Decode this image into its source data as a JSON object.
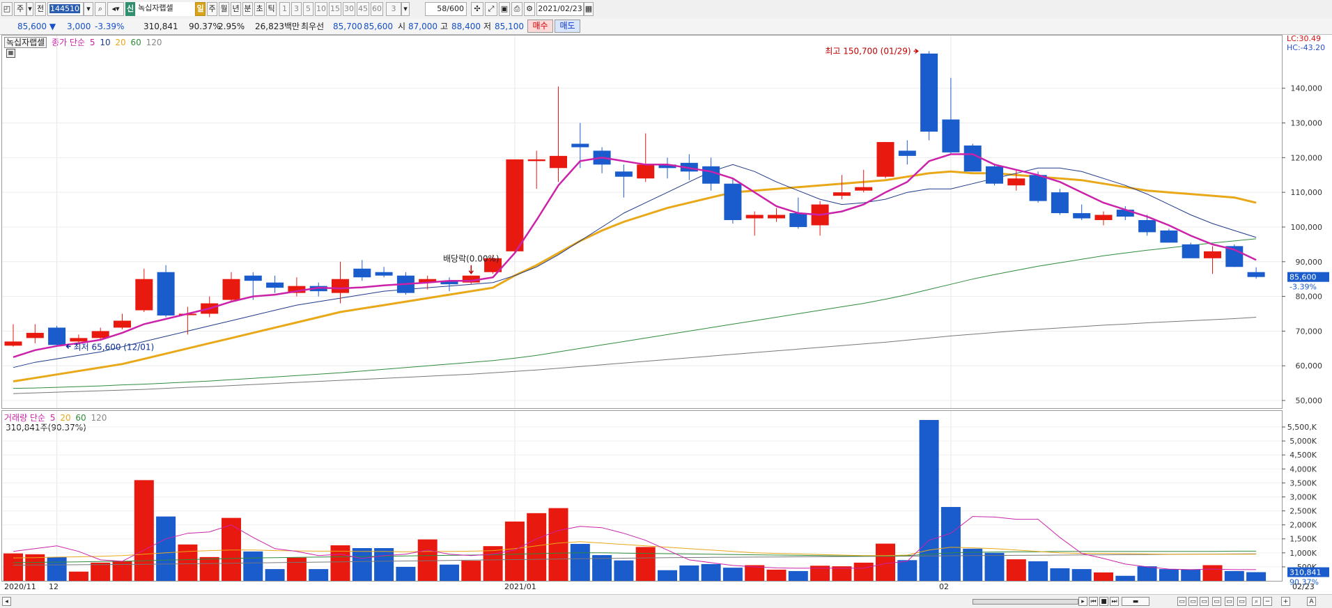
{
  "toolbar": {
    "mode_char": "주",
    "prev_char": "전",
    "code": "144510",
    "tag": "신",
    "stock_name": "녹십자랩셀",
    "periods": [
      "일",
      "주",
      "월",
      "년",
      "분",
      "초",
      "틱"
    ],
    "intervals": [
      "1",
      "3",
      "5",
      "10",
      "15",
      "30",
      "45",
      "60"
    ],
    "interval_value": "3",
    "count": "58/600",
    "date": "2021/02/23"
  },
  "quote": {
    "price": "85,600",
    "arrow": "▼",
    "change": "3,000",
    "change_pct": "-3.39%",
    "volume": "310,841",
    "vol_ratio": "90.37%",
    "turnover": "2.95%",
    "amount": "26,823백만",
    "best_label": "최우선",
    "best_ask": "85,700",
    "best_bid": "85,600",
    "open_label": "시",
    "open": "87,000",
    "high_label": "고",
    "high": "88,400",
    "low_label": "저",
    "low": "85,100",
    "buy_label": "매수",
    "sell_label": "매도"
  },
  "price_legend": {
    "name": "녹십자랩셀",
    "ma_label": "종가 단순",
    "periods": [
      "5",
      "10",
      "20",
      "60",
      "120"
    ]
  },
  "volume_legend": {
    "ma_label": "거래량 단순",
    "periods": [
      "5",
      "20",
      "60",
      "120"
    ],
    "current": "310,841주(90.37%)"
  },
  "side_labels": {
    "lc": "LC:30.49",
    "hc": "HC:-43.20",
    "last_price": "85,600",
    "last_pct": "-3.39%",
    "last_vol": "310,841",
    "last_vol_pct": "90.37%"
  },
  "annotations": {
    "high": "최고 150,700 (01/29)",
    "low": "최저 65,600 (12/01)",
    "dividend": "배당락(0.00%)"
  },
  "x_labels": [
    "2020/11",
    "12",
    "2021/01",
    "02",
    "02/23"
  ],
  "colors": {
    "up": "#e8190e",
    "down": "#1a5ccc",
    "ma5": "#cc22aa",
    "ma10": "#1f3a8a",
    "ma20": "#e8a818",
    "ma60": "#2e8b3c",
    "ma120": "#777777"
  },
  "chart_data": [
    {
      "type": "candlestick",
      "title": "녹십자랩셀",
      "ylim": [
        48000,
        155000
      ],
      "yticks": [
        "50,000",
        "60,000",
        "70,000",
        "80,000",
        "90,000",
        "100,000",
        "110,000",
        "120,000",
        "130,000",
        "140,000"
      ],
      "ohlc": [
        {
          "o": 65800,
          "h": 72000,
          "l": 65500,
          "c": 67000
        },
        {
          "o": 68000,
          "h": 72000,
          "l": 66500,
          "c": 69500
        },
        {
          "o": 71000,
          "h": 71500,
          "l": 65600,
          "c": 66000
        },
        {
          "o": 67000,
          "h": 69000,
          "l": 66200,
          "c": 68000
        },
        {
          "o": 68000,
          "h": 71000,
          "l": 67500,
          "c": 70000
        },
        {
          "o": 71000,
          "h": 75000,
          "l": 70500,
          "c": 73000
        },
        {
          "o": 76000,
          "h": 88000,
          "l": 75500,
          "c": 85000
        },
        {
          "o": 87000,
          "h": 89000,
          "l": 74000,
          "c": 74500
        },
        {
          "o": 75000,
          "h": 77000,
          "l": 69000,
          "c": 75000
        },
        {
          "o": 75000,
          "h": 80000,
          "l": 74000,
          "c": 78000
        },
        {
          "o": 79000,
          "h": 87000,
          "l": 78500,
          "c": 85000
        },
        {
          "o": 86000,
          "h": 87000,
          "l": 79000,
          "c": 84500
        },
        {
          "o": 84000,
          "h": 86000,
          "l": 81000,
          "c": 82500
        },
        {
          "o": 81000,
          "h": 85500,
          "l": 80000,
          "c": 83000
        },
        {
          "o": 83000,
          "h": 84000,
          "l": 80000,
          "c": 81500
        },
        {
          "o": 81000,
          "h": 90000,
          "l": 78000,
          "c": 85000
        },
        {
          "o": 88000,
          "h": 90500,
          "l": 84500,
          "c": 85500
        },
        {
          "o": 87000,
          "h": 88500,
          "l": 85500,
          "c": 86000
        },
        {
          "o": 86000,
          "h": 87000,
          "l": 80500,
          "c": 81000
        },
        {
          "o": 84000,
          "h": 86000,
          "l": 82000,
          "c": 85000
        },
        {
          "o": 84500,
          "h": 85500,
          "l": 81500,
          "c": 83500
        },
        {
          "o": 84000,
          "h": 86000,
          "l": 83500,
          "c": 86000
        },
        {
          "o": 87000,
          "h": 92000,
          "l": 86500,
          "c": 91000
        },
        {
          "o": 93000,
          "h": 119500,
          "l": 92500,
          "c": 119500
        },
        {
          "o": 119000,
          "h": 122000,
          "l": 111000,
          "c": 119500
        },
        {
          "o": 117000,
          "h": 140500,
          "l": 113000,
          "c": 120500
        },
        {
          "o": 124000,
          "h": 130000,
          "l": 117000,
          "c": 123000
        },
        {
          "o": 122000,
          "h": 123000,
          "l": 115500,
          "c": 118000
        },
        {
          "o": 116000,
          "h": 118000,
          "l": 108500,
          "c": 114500
        },
        {
          "o": 114000,
          "h": 127000,
          "l": 113000,
          "c": 118000
        },
        {
          "o": 118000,
          "h": 120000,
          "l": 114000,
          "c": 117000
        },
        {
          "o": 118500,
          "h": 121000,
          "l": 113500,
          "c": 116000
        },
        {
          "o": 117500,
          "h": 120000,
          "l": 110500,
          "c": 112500
        },
        {
          "o": 112500,
          "h": 114000,
          "l": 101000,
          "c": 102000
        },
        {
          "o": 102500,
          "h": 104500,
          "l": 97500,
          "c": 103500
        },
        {
          "o": 102500,
          "h": 105500,
          "l": 101500,
          "c": 103500
        },
        {
          "o": 104000,
          "h": 108500,
          "l": 99500,
          "c": 100000
        },
        {
          "o": 100500,
          "h": 107500,
          "l": 97500,
          "c": 106500
        },
        {
          "o": 109000,
          "h": 115000,
          "l": 108000,
          "c": 110000
        },
        {
          "o": 110500,
          "h": 116500,
          "l": 110000,
          "c": 111500
        },
        {
          "o": 114500,
          "h": 124500,
          "l": 114000,
          "c": 124500
        },
        {
          "o": 122000,
          "h": 125000,
          "l": 118000,
          "c": 120500
        },
        {
          "o": 150000,
          "h": 150700,
          "l": 125000,
          "c": 127500
        },
        {
          "o": 131000,
          "h": 143000,
          "l": 121000,
          "c": 121500
        },
        {
          "o": 123500,
          "h": 124000,
          "l": 116000,
          "c": 116000
        },
        {
          "o": 117500,
          "h": 118000,
          "l": 112000,
          "c": 112500
        },
        {
          "o": 112000,
          "h": 116500,
          "l": 110500,
          "c": 114000
        },
        {
          "o": 115000,
          "h": 116000,
          "l": 107000,
          "c": 107500
        },
        {
          "o": 110000,
          "h": 111000,
          "l": 103500,
          "c": 104000
        },
        {
          "o": 104000,
          "h": 106500,
          "l": 102000,
          "c": 102500
        },
        {
          "o": 102000,
          "h": 104500,
          "l": 100500,
          "c": 103500
        },
        {
          "o": 105000,
          "h": 106000,
          "l": 102000,
          "c": 103000
        },
        {
          "o": 102000,
          "h": 103500,
          "l": 97500,
          "c": 98500
        },
        {
          "o": 99000,
          "h": 99500,
          "l": 95500,
          "c": 95500
        },
        {
          "o": 95000,
          "h": 95500,
          "l": 91000,
          "c": 91000
        },
        {
          "o": 91000,
          "h": 94500,
          "l": 86500,
          "c": 93000
        },
        {
          "o": 94500,
          "h": 95000,
          "l": 88500,
          "c": 88500
        },
        {
          "o": 87000,
          "h": 88400,
          "l": 85100,
          "c": 85600
        }
      ],
      "ma5": [
        62500,
        64500,
        65700,
        66500,
        67500,
        69500,
        72000,
        73500,
        75000,
        76500,
        78500,
        80000,
        80500,
        81500,
        82500,
        82300,
        82600,
        83200,
        83600,
        84000,
        84500,
        84500,
        85500,
        92500,
        102000,
        112000,
        119000,
        120000,
        119000,
        118000,
        118000,
        117000,
        116000,
        114000,
        110000,
        106000,
        104000,
        103500,
        104500,
        106500,
        110000,
        113000,
        119000,
        121000,
        121000,
        118000,
        116500,
        115000,
        113000,
        110000,
        107000,
        105000,
        103000,
        100500,
        97500,
        95000,
        93500,
        90500
      ],
      "ma10": [
        59500,
        61000,
        62000,
        63000,
        64000,
        65500,
        67000,
        68500,
        70000,
        71500,
        73000,
        74500,
        76000,
        77500,
        78500,
        79500,
        80500,
        81500,
        82000,
        82500,
        83000,
        83500,
        84000,
        86000,
        88500,
        92000,
        96000,
        100000,
        104000,
        107000,
        110000,
        113000,
        116000,
        118000,
        116000,
        113000,
        110500,
        108000,
        106500,
        107000,
        108000,
        110000,
        111000,
        111000,
        112500,
        114000,
        115500,
        117000,
        117000,
        116000,
        114000,
        112000,
        109500,
        106500,
        103500,
        101000,
        99000,
        97000
      ],
      "ma20": [
        55500,
        56500,
        57500,
        58500,
        59500,
        60500,
        62000,
        63500,
        65000,
        66500,
        68000,
        69500,
        71000,
        72500,
        74000,
        75500,
        76500,
        77500,
        78500,
        79500,
        80500,
        81500,
        82500,
        86000,
        89000,
        92500,
        96000,
        99000,
        101500,
        103500,
        105500,
        107000,
        108500,
        110000,
        110500,
        111000,
        111500,
        112000,
        112500,
        113000,
        113500,
        114500,
        115500,
        116000,
        115500,
        115500,
        115000,
        114500,
        114000,
        113500,
        112500,
        111500,
        110500,
        110000,
        109500,
        109000,
        108500,
        107000
      ],
      "ma60": [
        53500,
        53600,
        53800,
        54000,
        54200,
        54500,
        54700,
        55000,
        55300,
        55600,
        56000,
        56400,
        56800,
        57200,
        57600,
        58000,
        58500,
        59000,
        59500,
        60000,
        60500,
        61000,
        61500,
        62200,
        63000,
        64000,
        65000,
        66000,
        67000,
        68000,
        69000,
        70000,
        71000,
        72000,
        73000,
        74000,
        75000,
        76000,
        77000,
        78000,
        79200,
        80500,
        82000,
        83500,
        85000,
        86300,
        87500,
        88700,
        89700,
        90700,
        91700,
        92500,
        93300,
        94000,
        94700,
        95400,
        96000,
        96600
      ],
      "ma120": [
        52000,
        52200,
        52400,
        52600,
        52800,
        53000,
        53200,
        53500,
        53800,
        54000,
        54300,
        54600,
        54900,
        55200,
        55500,
        55800,
        56100,
        56400,
        56700,
        57000,
        57300,
        57600,
        58000,
        58400,
        58800,
        59300,
        59800,
        60300,
        60800,
        61300,
        61800,
        62300,
        62800,
        63300,
        63800,
        64300,
        64800,
        65300,
        65800,
        66300,
        66800,
        67400,
        68000,
        68600,
        69100,
        69600,
        70100,
        70500,
        70900,
        71300,
        71700,
        72000,
        72400,
        72700,
        73000,
        73300,
        73600,
        74000
      ]
    },
    {
      "type": "bar",
      "title": "거래량",
      "ylim": [
        0,
        5900
      ],
      "yticks": [
        "500",
        "1,000",
        "1,500",
        "2,000",
        "2,500",
        "3,000",
        "3,500",
        "4,000",
        "4,500",
        "5,000",
        "5,500,"
      ],
      "unit": "K",
      "volume": [
        980,
        950,
        850,
        330,
        650,
        700,
        3600,
        2300,
        1300,
        850,
        2250,
        1050,
        420,
        830,
        420,
        1270,
        1170,
        1170,
        500,
        1480,
        580,
        720,
        1240,
        2120,
        2420,
        2600,
        1320,
        920,
        730,
        1210,
        380,
        550,
        600,
        470,
        560,
        400,
        350,
        540,
        520,
        650,
        1330,
        740,
        5750,
        2640,
        1150,
        1000,
        770,
        700,
        450,
        420,
        300,
        180,
        520,
        420,
        400,
        560,
        350,
        310
      ],
      "ma5": [
        1050,
        1150,
        1250,
        1050,
        750,
        700,
        1100,
        1500,
        1700,
        1750,
        2000,
        1550,
        1150,
        1050,
        900,
        950,
        800,
        900,
        950,
        1100,
        950,
        900,
        950,
        1100,
        1500,
        1800,
        1950,
        1900,
        1700,
        1450,
        1100,
        750,
        650,
        550,
        500,
        460,
        450,
        450,
        450,
        450,
        620,
        700,
        1450,
        1700,
        2300,
        2280,
        2200,
        2200,
        1550,
        980,
        800,
        600,
        500,
        420,
        400,
        420,
        400,
        400
      ],
      "ma20": [
        820,
        830,
        850,
        860,
        880,
        900,
        950,
        1000,
        1050,
        1080,
        1100,
        1100,
        1080,
        1070,
        1060,
        1060,
        1050,
        1050,
        1040,
        1050,
        1050,
        1060,
        1080,
        1150,
        1250,
        1350,
        1400,
        1350,
        1300,
        1250,
        1200,
        1150,
        1100,
        1050,
        1000,
        980,
        960,
        940,
        920,
        900,
        900,
        920,
        1100,
        1200,
        1180,
        1150,
        1100,
        1050,
        1000,
        980,
        980,
        970,
        960,
        950,
        950,
        950,
        950,
        950
      ],
      "ma60": [
        650,
        660,
        670,
        680,
        690,
        700,
        720,
        740,
        760,
        780,
        800,
        820,
        830,
        840,
        850,
        860,
        870,
        880,
        890,
        900,
        910,
        920,
        930,
        950,
        970,
        990,
        1000,
        1000,
        990,
        980,
        970,
        960,
        950,
        940,
        930,
        920,
        910,
        900,
        890,
        890,
        890,
        900,
        950,
        1000,
        1020,
        1030,
        1040,
        1040,
        1050,
        1050,
        1050,
        1050,
        1050,
        1050,
        1050,
        1050,
        1060,
        1060
      ],
      "ma120": [
        560,
        565,
        570,
        575,
        580,
        585,
        590,
        600,
        610,
        620,
        630,
        640,
        650,
        660,
        670,
        680,
        690,
        700,
        710,
        720,
        730,
        740,
        750,
        760,
        770,
        780,
        790,
        800,
        810,
        820,
        830,
        835,
        840,
        845,
        850,
        855,
        860,
        865,
        870,
        875,
        880,
        885,
        890,
        895,
        900,
        905,
        910,
        915,
        920,
        925,
        930,
        935,
        940,
        945,
        950,
        955,
        960,
        965
      ]
    }
  ]
}
